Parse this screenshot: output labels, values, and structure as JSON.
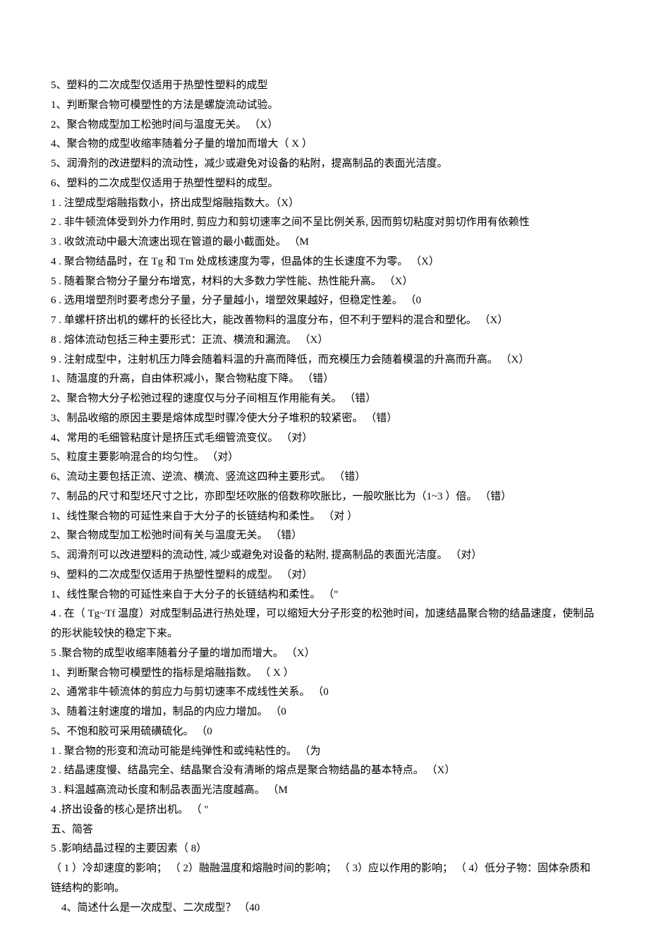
{
  "lines": [
    {
      "text": "5、塑料的二次成型仅适用于热塑性塑料的成型",
      "indent": false
    },
    {
      "text": "1、判断聚合物可模塑性的方法是螺旋流动试验。",
      "indent": false
    },
    {
      "text": "2、聚合物成型加工松弛时间与温度无关。 （X）",
      "indent": false
    },
    {
      "text": "4、聚合物的成型收缩率随着分子量的增加而增大（  X ）",
      "indent": false
    },
    {
      "text": "5、润滑剂的改进塑料的流动性，减少或避免对设备的粘附，提高制品的表面光洁度。",
      "indent": false
    },
    {
      "text": "6、塑料的二次成型仅适用于热塑性塑料的成型。",
      "indent": false
    },
    {
      "text": "1 . 注塑成型熔融指数小，挤出成型熔融指数大。（X）",
      "indent": false
    },
    {
      "text": "2 . 非牛顿流体受到外力作用时, 剪应力和剪切速率之间不呈比例关系, 因而剪切粘度对剪切作用有依赖性",
      "indent": false
    },
    {
      "text": "3 . 收敛流动中最大流速出现在管道的最小截面处。 （M",
      "indent": false
    },
    {
      "text": "4 . 聚合物结晶时，在  Tg 和 Tm 处成核速度为零，但晶体的生长速度不为零。 （X）",
      "indent": false
    },
    {
      "text": "5 . 随着聚合物分子量分布增宽，材料的大多数力学性能、热性能升高。 （X）",
      "indent": false
    },
    {
      "text": "6 . 选用增塑剂时要考虑分子量，分子量越小，增塑效果越好，但稳定性差。 （0",
      "indent": false
    },
    {
      "text": "7 . 单螺杆挤出机的螺杆的长径比大，能改善物料的温度分布，但不利于塑料的混合和塑化。 （X）",
      "indent": false
    },
    {
      "text": "8 . 熔体流动包括三种主要形式：正流、横流和漏流。 （X）",
      "indent": false
    },
    {
      "text": "9 . 注射成型中，注射机压力降会随着料温的升高而降低，而充模压力会随着模温的升高而升高。 （X）",
      "indent": false
    },
    {
      "text": "1、随温度的升高，自由体积减小，聚合物粘度下降。 （错）",
      "indent": false
    },
    {
      "text": "2、聚合物大分子松弛过程的速度仅与分子间相互作用能有关。 （错）",
      "indent": false
    },
    {
      "text": "3、制品收缩的原因主要是熔体成型时骤冷使大分子堆积的较紧密。 （错）",
      "indent": false
    },
    {
      "text": "4、常用的毛细管粘度计是挤压式毛细管流变仪。 （对）",
      "indent": false
    },
    {
      "text": "5、粒度主要影响混合的均匀性。 （对）",
      "indent": false
    },
    {
      "text": "6、流动主要包括正流、逆流、横流、竖流这四种主要形式。 （错）",
      "indent": false
    },
    {
      "text": "7、制品的尺寸和型坯尺寸之比，亦即型坯吹胀的倍数称吹胀比，一般吹胀比为（1~3 ）倍。 （错）",
      "indent": false
    },
    {
      "text": "1、线性聚合物的可延性来自于大分子的长链结构和柔性。  （对 ）",
      "indent": false
    },
    {
      "text": "2、聚合物成型加工松弛时间有关与温度无关。  （错）",
      "indent": false
    },
    {
      "text": "5、润滑剂可以改进塑料的流动性, 减少或避免对设备的粘附,  提高制品的表面光洁度。  （对）",
      "indent": false
    },
    {
      "text": "9、塑料的二次成型仅适用于热塑性塑料的成型。 （对）",
      "indent": false
    },
    {
      "text": "1、线性聚合物的可延性来自于大分子的长链结构和柔性。 （\"",
      "indent": false
    },
    {
      "text": "4 . 在（  Tg~Tf 温度）对成型制品进行热处理，可以缩短大分子形变的松弛时间，加速结晶聚合物的结晶速度，使制品的形状能较快的稳定下来。",
      "indent": false
    },
    {
      "text": "5 .聚合物的成型收缩率随着分子量的增加而增大。 （X）",
      "indent": false
    },
    {
      "text": "1、判断聚合物可模塑性的指标是熔融指数。  （  X ）",
      "indent": false
    },
    {
      "text": "2、通常非牛顿流体的剪应力与剪切速率不成线性关系。 （0",
      "indent": false
    },
    {
      "text": "3、随着注射速度的增加，制品的内应力增加。 （0",
      "indent": false
    },
    {
      "text": "5、不饱和胶可采用硫磺硫化。 （0",
      "indent": false
    },
    {
      "text": "1 . 聚合物的形变和流动可能是纯弹性和或纯粘性的。 （为",
      "indent": false
    },
    {
      "text": "2 . 结晶速度慢、结晶完全、结晶聚合没有清晰的熔点是聚合物结晶的基本特点。 （X）",
      "indent": false
    },
    {
      "text": "3 . 料温越高流动长度和制品表面光洁度越高。 （M",
      "indent": false
    },
    {
      "text": "4 .挤出设备的核心是挤出机。 （ \"",
      "indent": false
    },
    {
      "text": "五、简答",
      "indent": false
    },
    {
      "text": "5 .影响结晶过程的主要因素（  8）",
      "indent": false
    },
    {
      "text": "（ 1 ）冷却速度的影响； （ 2）融融温度和熔融时间的影响； （ 3）应以作用的影响； （ 4）低分子物：固体杂质和链结构的影响。",
      "indent": false
    },
    {
      "text": "4、简述什么是一次成型、二次成型？  （40",
      "indent": true
    }
  ]
}
